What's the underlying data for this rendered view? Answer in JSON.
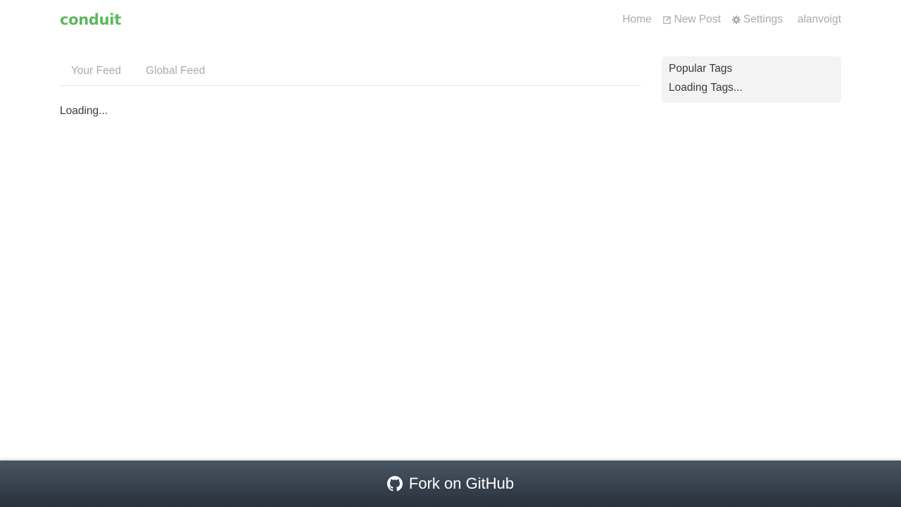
{
  "navbar": {
    "brand": "conduit",
    "links": {
      "home": "Home",
      "new_post": "New Post",
      "settings": "Settings",
      "user": "alanvoigt"
    },
    "icons": {
      "new_post": "edit-icon",
      "settings": "gear-icon"
    }
  },
  "feed": {
    "tabs": [
      "Your Feed",
      "Global Feed"
    ],
    "loading_text": "Loading..."
  },
  "sidebar": {
    "title": "Popular Tags",
    "loading_text": "Loading Tags..."
  },
  "footer": {
    "label": "Fork on GitHub",
    "icon": "github-icon"
  },
  "colors": {
    "brand": "#5cb85c",
    "nav_link": "#aaaaaa",
    "text": "#373a3c",
    "sidebar_bg": "#f3f3f3",
    "footer_gradient_top": "#485563",
    "footer_gradient_bottom": "#29323c"
  }
}
